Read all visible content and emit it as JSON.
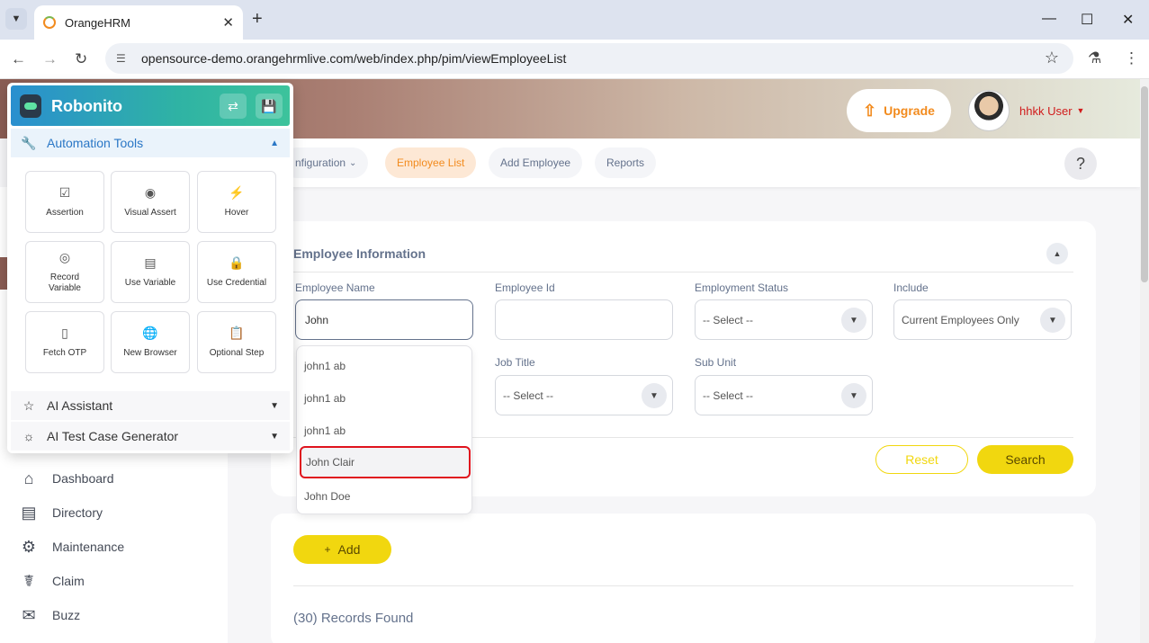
{
  "browser": {
    "tab_title": "OrangeHRM",
    "url": "opensource-demo.orangehrmlive.com/web/index.php/pim/viewEmployeeList"
  },
  "header": {
    "upgrade_label": "Upgrade",
    "user_name": "hhkk User"
  },
  "topnav": {
    "items": [
      "nfiguration",
      "Employee List",
      "Add Employee",
      "Reports"
    ],
    "help": "?"
  },
  "sidebar": {
    "items": [
      "Dashboard",
      "Directory",
      "Maintenance",
      "Claim",
      "Buzz"
    ]
  },
  "form": {
    "title": "Employee Information",
    "labels": {
      "employee_name": "Employee Name",
      "employee_id": "Employee Id",
      "employment_status": "Employment Status",
      "include": "Include",
      "job_title": "Job Title",
      "sub_unit": "Sub Unit"
    },
    "values": {
      "employee_name": "John",
      "employment_status": "-- Select --",
      "include": "Current Employees Only",
      "job_title": "-- Select --",
      "sub_unit": "-- Select --"
    },
    "reset_label": "Reset",
    "search_label": "Search"
  },
  "autocomplete": {
    "options": [
      "john1 ab",
      "john1 ab",
      "john1 ab",
      "John Clair",
      "John Doe"
    ],
    "highlighted_index": 3
  },
  "list": {
    "add_label": "Add",
    "add_plus": "+",
    "records": "(30) Records Found"
  },
  "robonito": {
    "title": "Robonito",
    "section_automation": "Automation Tools",
    "tools": [
      "Assertion",
      "Visual Assert",
      "Hover",
      "Record Variable",
      "Use Variable",
      "Use Credential",
      "Fetch OTP",
      "New Browser",
      "Optional Step"
    ],
    "section_ai_assistant": "AI Assistant",
    "section_ai_testgen": "AI Test Case Generator"
  },
  "colors": {
    "accent_orange": "#f28b1e",
    "button_yellow": "#f1d70f",
    "highlight_red": "#e0141e",
    "robonito_blue": "#2a77c6"
  }
}
